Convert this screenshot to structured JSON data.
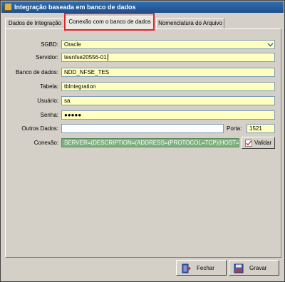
{
  "window": {
    "title": "Integração baseada em banco de dados"
  },
  "tabs": [
    {
      "label": "Dados de Integração"
    },
    {
      "label": "Conexão com o banco de dados"
    },
    {
      "label": "Nomenclatura do Arquivo"
    }
  ],
  "form": {
    "sgbd_label": "SGBD:",
    "sgbd_value": "Oracle",
    "servidor_label": "Servidor:",
    "servidor_value": "tesnfse20556-01",
    "banco_label": "Banco de dados:",
    "banco_value": "NDD_NFSE_TES",
    "tabela_label": "Tabela:",
    "tabela_value": "tbIntegration",
    "usuario_label": "Usuário:",
    "usuario_value": "sa",
    "senha_label": "Senha:",
    "senha_value": "●●●●●",
    "outros_label": "Outros Dados:",
    "outros_value": "",
    "porta_label": "Porta:",
    "porta_value": "1521",
    "conexao_label": "Conexão:",
    "conexao_value": "SERVER=(DESCRIPTION=(ADDRESS=(PROTOCOL=TCP)(HOST=tesnfs",
    "validar_label": "Validar"
  },
  "footer": {
    "fechar_label": "Fechar",
    "gravar_label": "Gravar"
  },
  "colors": {
    "field_bg": "#ffffc0",
    "conexao_bg": "#7fb07f",
    "tab_highlight": "#e4212a",
    "title_bar": "#2f6fb1"
  }
}
